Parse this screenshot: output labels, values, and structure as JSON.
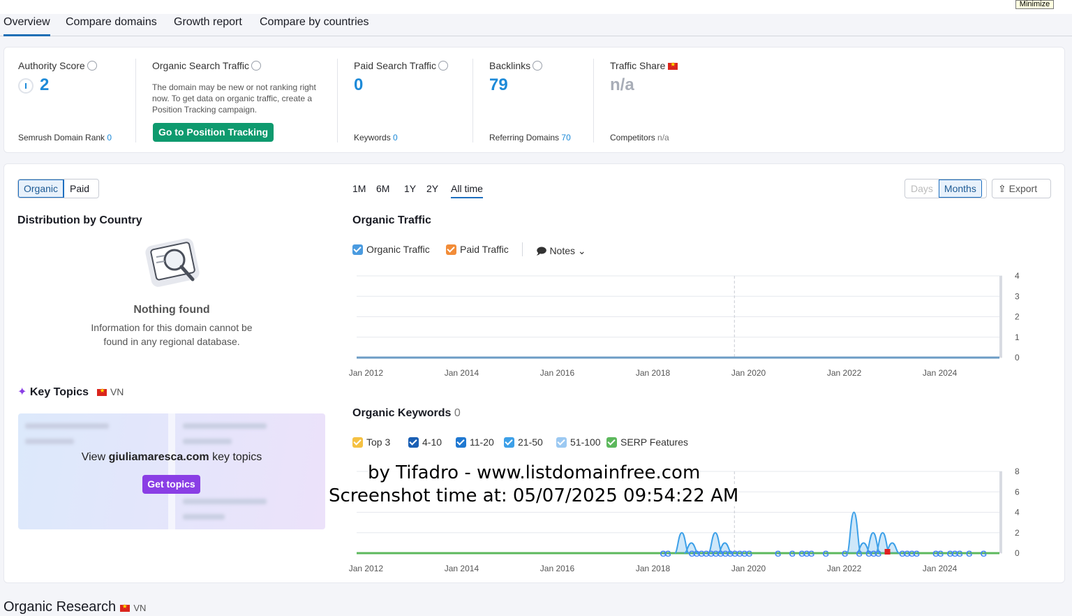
{
  "window": {
    "minimize_label": "Minimize"
  },
  "tabs": [
    {
      "label": "Overview",
      "active": true
    },
    {
      "label": "Compare domains"
    },
    {
      "label": "Growth report"
    },
    {
      "label": "Compare by countries"
    }
  ],
  "metrics": {
    "authority": {
      "title": "Authority Score",
      "value": "2",
      "sub_label": "Semrush Domain Rank",
      "sub_value": "0"
    },
    "organic": {
      "title": "Organic Search Traffic",
      "description": "The domain may be new or not ranking right now. To get data on organic traffic, create a Position Tracking campaign.",
      "button": "Go to Position Tracking"
    },
    "paid": {
      "title": "Paid Search Traffic",
      "value": "0",
      "sub_label": "Keywords",
      "sub_value": "0"
    },
    "backlinks": {
      "title": "Backlinks",
      "value": "79",
      "sub_label": "Referring Domains",
      "sub_value": "70"
    },
    "share": {
      "title": "Traffic Share",
      "value": "n/a",
      "sub_label": "Competitors",
      "sub_value": "n/a"
    }
  },
  "toggle": {
    "organic": "Organic",
    "paid": "Paid"
  },
  "distribution": {
    "title": "Distribution by Country",
    "empty_title": "Nothing found",
    "empty_text_1": "Information for this domain cannot be",
    "empty_text_2": "found in any regional database."
  },
  "key_topics": {
    "title": "Key Topics",
    "country": "VN",
    "view_prefix": "View",
    "domain": "giuliamaresca.com",
    "view_suffix": "key topics",
    "button": "Get topics"
  },
  "periods": [
    "1M",
    "6M",
    "1Y",
    "2Y",
    "All time"
  ],
  "granularity": {
    "days": "Days",
    "months": "Months"
  },
  "export_label": "Export",
  "organic_traffic": {
    "title": "Organic Traffic",
    "legend": {
      "organic": "Organic Traffic",
      "paid": "Paid Traffic",
      "notes": "Notes"
    }
  },
  "organic_keywords": {
    "title": "Organic Keywords",
    "count": "0",
    "legend": [
      {
        "label": "Top 3",
        "color": "#f5c142"
      },
      {
        "label": "4-10",
        "color": "#1a5fb4"
      },
      {
        "label": "11-20",
        "color": "#1f78d1"
      },
      {
        "label": "21-50",
        "color": "#3da0e8"
      },
      {
        "label": "51-100",
        "color": "#9cc9f2"
      },
      {
        "label": "SERP Features",
        "color": "#5cb85c"
      }
    ]
  },
  "chart_data": [
    {
      "type": "line",
      "title": "Organic Traffic",
      "x_ticks": [
        "Jan 2012",
        "Jan 2014",
        "Jan 2016",
        "Jan 2018",
        "Jan 2020",
        "Jan 2022",
        "Jan 2024"
      ],
      "y_ticks": [
        "0",
        "1",
        "2",
        "3",
        "4"
      ],
      "ylim": [
        0,
        4
      ],
      "series": [
        {
          "name": "Organic Traffic",
          "color": "#4a9be0",
          "values": [
            0,
            0,
            0,
            0,
            0,
            0,
            0
          ]
        },
        {
          "name": "Paid Traffic",
          "color": "#f28c38",
          "values": [
            0,
            0,
            0,
            0,
            0,
            0,
            0
          ]
        }
      ]
    },
    {
      "type": "area",
      "title": "Organic Keywords",
      "x_ticks": [
        "Jan 2012",
        "Jan 2014",
        "Jan 2016",
        "Jan 2018",
        "Jan 2020",
        "Jan 2022",
        "Jan 2024"
      ],
      "y_ticks": [
        "0",
        "2",
        "4",
        "6",
        "8"
      ],
      "ylim": [
        0,
        8
      ],
      "x": [
        2018.3,
        2018.6,
        2018.8,
        2019.0,
        2019.3,
        2019.5,
        2019.7,
        2019.9,
        2022.2,
        2022.4,
        2022.6,
        2022.8,
        2023.0,
        2023.2
      ],
      "series": [
        {
          "name": "51-100",
          "color": "#3da0e8",
          "values": [
            0,
            2,
            1,
            0,
            2,
            1,
            0,
            0,
            4,
            1,
            2,
            2,
            1,
            0
          ]
        }
      ]
    }
  ],
  "bottom": {
    "title": "Organic Research",
    "country": "VN"
  },
  "watermark": {
    "line1": "by Tifadro - www.listdomainfree.com",
    "line2": "Screenshot time at: 05/07/2025 09:54:22 AM"
  }
}
